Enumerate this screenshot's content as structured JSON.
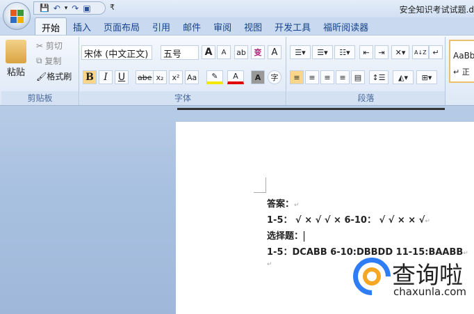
{
  "window": {
    "title": "安全知识考试试题.d"
  },
  "qat": {
    "save": "💾",
    "undo": "↶",
    "undo_drop": "▾",
    "redo": "↷",
    "print": "▣",
    "customize": "₹"
  },
  "tabs": [
    "开始",
    "插入",
    "页面布局",
    "引用",
    "邮件",
    "审阅",
    "视图",
    "开发工具",
    "福昕阅读器"
  ],
  "clipboard": {
    "paste": "粘贴",
    "cut": "剪切",
    "copy": "复制",
    "format_painter": "格式刷",
    "label": "剪贴板"
  },
  "font": {
    "name": "宋体 (中文正文)",
    "size": "五号",
    "grow": "A",
    "shrink": "A",
    "clear": "ab",
    "phonetic": "变",
    "border": "A",
    "bold": "B",
    "italic": "I",
    "underline": "U",
    "strike": "abe",
    "sub": "x₂",
    "sup": "x²",
    "case": "Aa",
    "shade": "A",
    "circle": "字",
    "label": "字体",
    "highlight_color": "#f5e800",
    "font_color": "#e00000"
  },
  "paragraph": {
    "label": "段落",
    "sort": "A↓Z",
    "marks": "↵"
  },
  "styles": {
    "preview": "AaBb",
    "sub": "↵ 正"
  },
  "document": {
    "lines": [
      "答案：",
      "1-5： √ × √ √ ×    6-10： √ √ × × √",
      "选择题：",
      "1-5：DCABB   6-10:DBBDD   11-15:BAABB"
    ]
  },
  "watermark": {
    "brand": "查询啦",
    "url": "chaxunla.com",
    "blue": "#2e7cf6",
    "orange": "#f5a623"
  }
}
